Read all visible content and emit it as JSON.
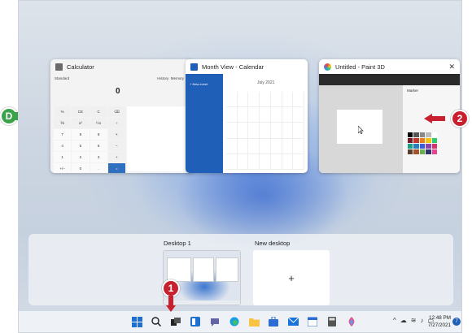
{
  "windows": [
    {
      "title": "Calculator",
      "mode": "Standard",
      "display": "0",
      "tabs": [
        "History",
        "Memory"
      ]
    },
    {
      "title": "Month View - Calendar",
      "new_event": "+ New event",
      "month": "July 2021"
    },
    {
      "title": "Untitled - Paint 3D",
      "close": "✕",
      "panel": "Marker"
    }
  ],
  "calc_keys": [
    "%",
    "CE",
    "C",
    "⌫",
    "⅟x",
    "x²",
    "²√x",
    "÷",
    "7",
    "8",
    "9",
    "×",
    "4",
    "5",
    "6",
    "−",
    "1",
    "2",
    "3",
    "+",
    "+/−",
    "0",
    ".",
    "="
  ],
  "desktops": {
    "desktop1": "Desktop 1",
    "new_desktop": "New desktop",
    "add_symbol": "+"
  },
  "taskbar": {
    "time": "12:48 PM",
    "date": "7/27/2021",
    "notifications": "7",
    "chevron": "^"
  },
  "callouts": {
    "d": "D",
    "one": "1",
    "two": "2"
  },
  "colors": {
    "callout_green": "#3aa24a",
    "callout_red": "#c8202f",
    "accent": "#1f5fb8"
  }
}
